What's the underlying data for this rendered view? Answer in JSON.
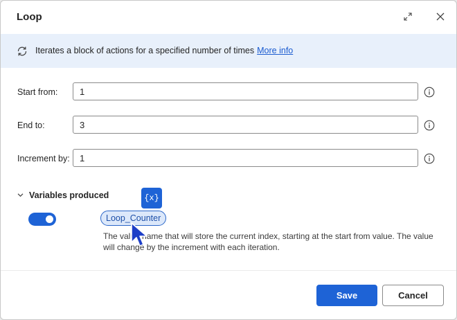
{
  "dialog": {
    "title": "Loop",
    "expand_icon": "expand-diagonal-icon",
    "close_icon": "close-icon"
  },
  "banner": {
    "icon": "loop-arrows-icon",
    "text": "Iterates a block of actions for a specified number of times",
    "link": "More info"
  },
  "fields": {
    "start": {
      "label": "Start from:",
      "value": "1"
    },
    "end": {
      "label": "End to:",
      "value": "3"
    },
    "increment": {
      "label": "Increment by:",
      "value": "1"
    }
  },
  "variables": {
    "section_title": "Variables produced",
    "badge": "{x}",
    "toggle_on": true,
    "variable_name": "Loop_Counter",
    "description": "The value name that will store the current index, starting at the start from value. The value will change by the increment with each iteration."
  },
  "footer": {
    "save_label": "Save",
    "cancel_label": "Cancel"
  },
  "colors": {
    "accent": "#1e63d6",
    "banner_bg": "#e8f0fb",
    "link": "#1a5bd0"
  }
}
